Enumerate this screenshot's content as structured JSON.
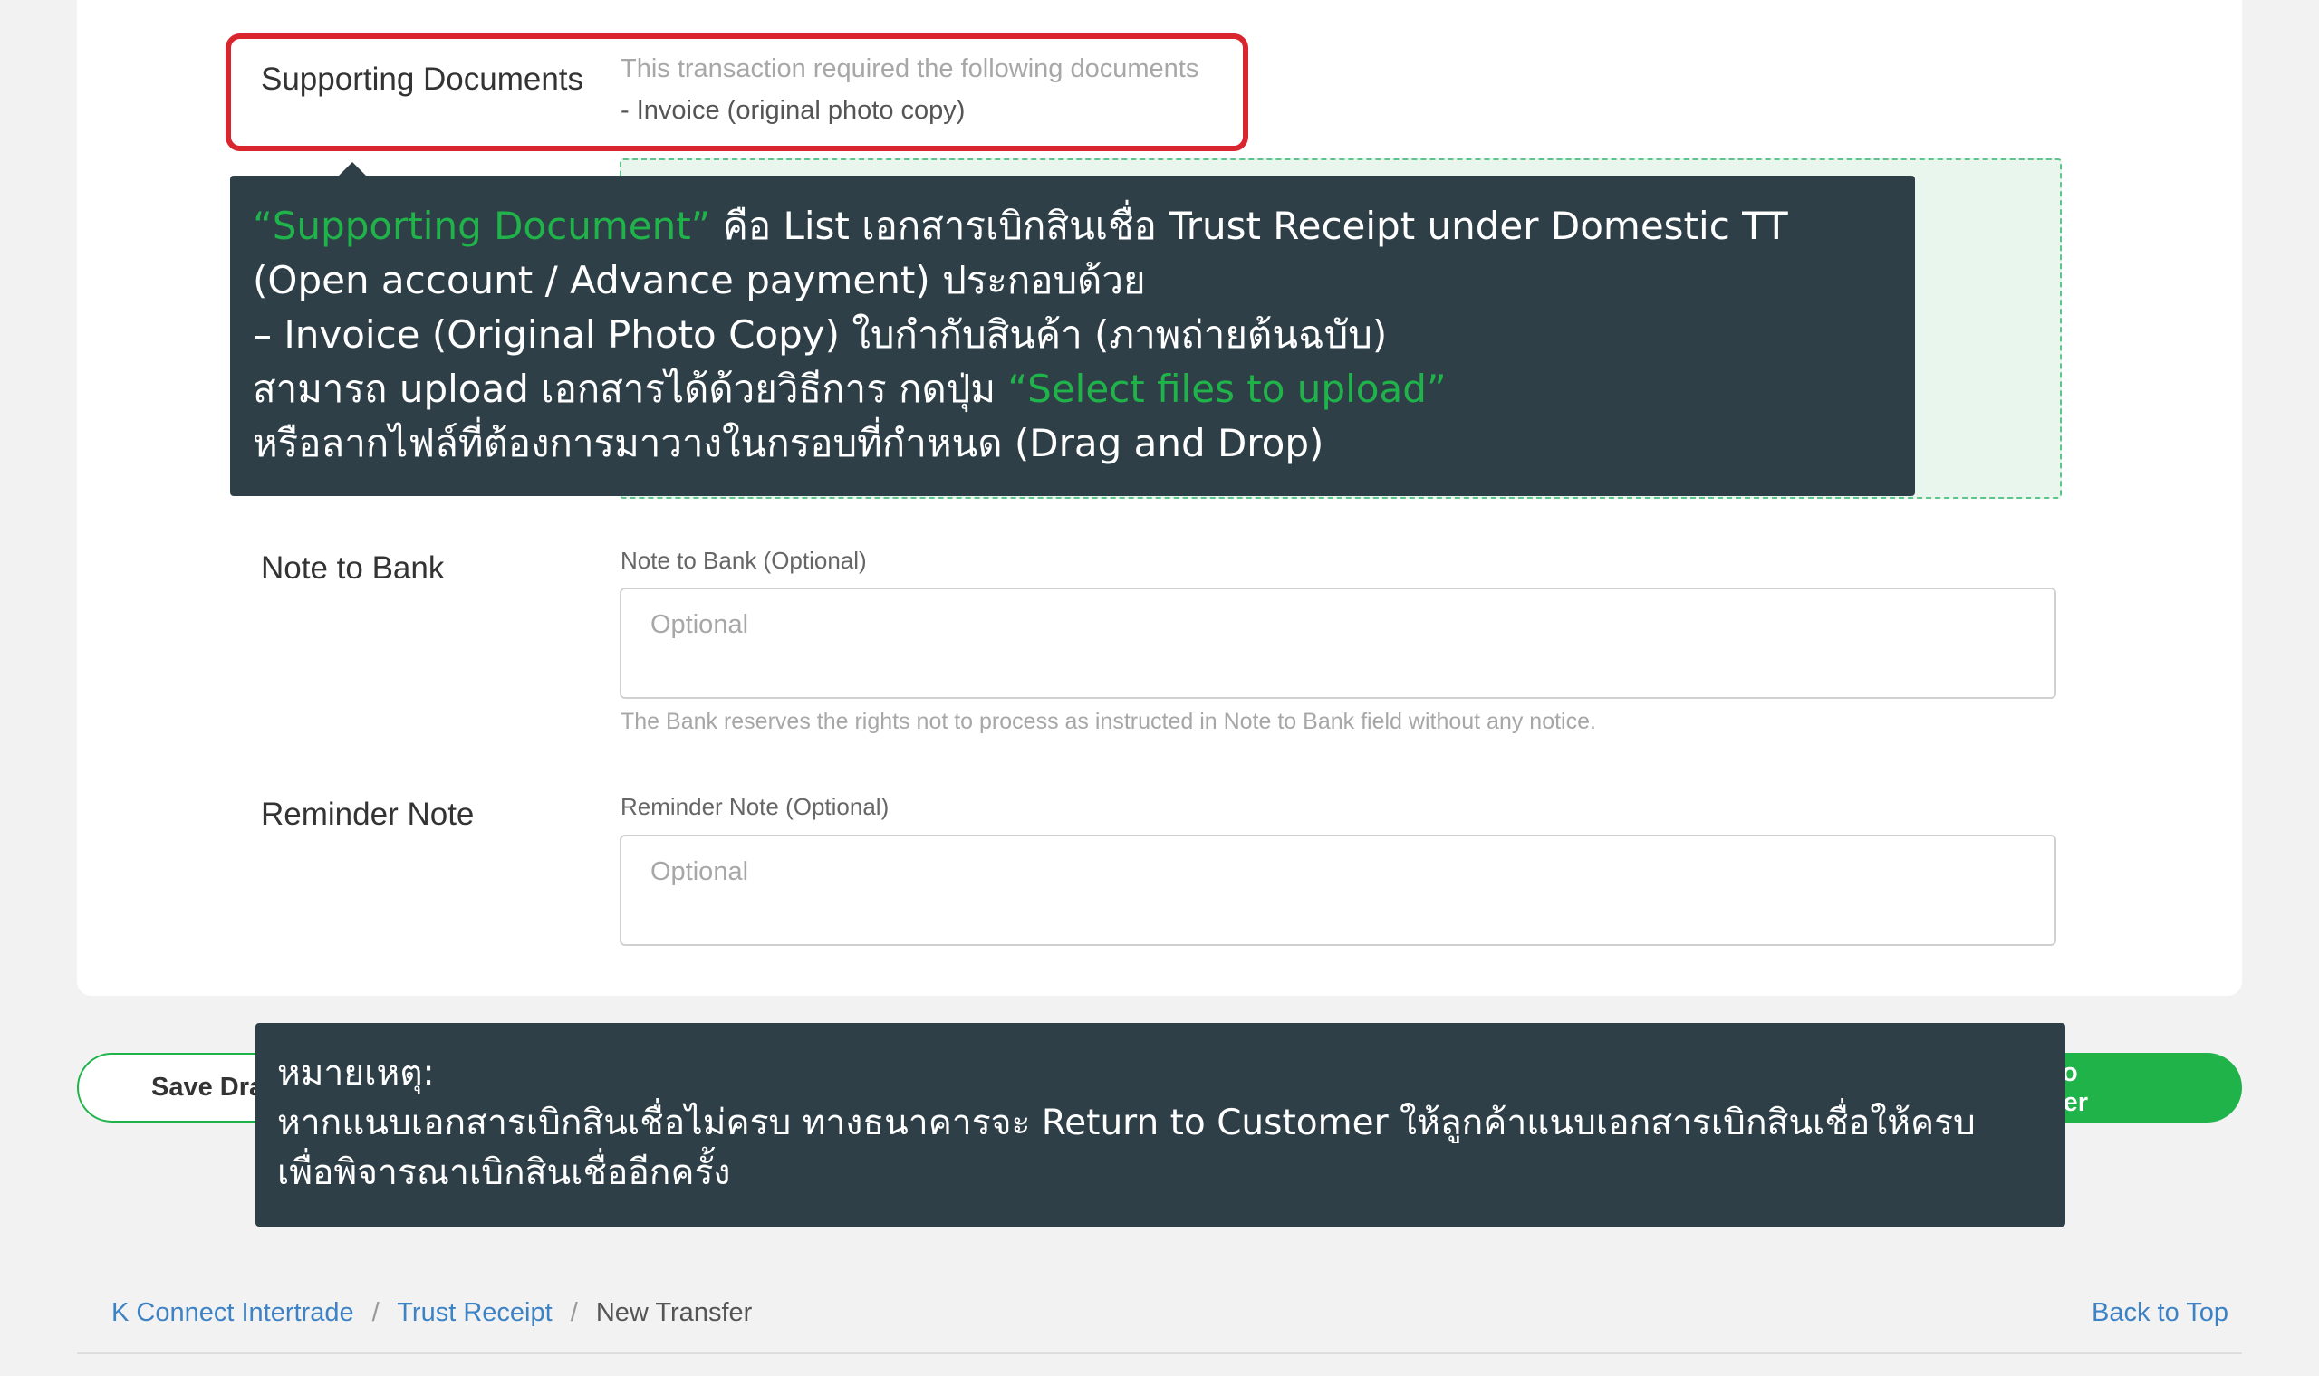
{
  "supporting": {
    "label": "Supporting Documents",
    "required_title": "This transaction required the following documents",
    "required_item": "- Invoice (original photo copy)"
  },
  "tooltip_main": {
    "l1_hl": "“Supporting Document”",
    "l1_rest": " คือ List เอกสารเบิกสินเชื่อ Trust Receipt under Domestic TT",
    "l2": "(Open account / Advance payment) ประกอบด้วย",
    "l3": "– Invoice (Original Photo Copy) ใบกำกับสินค้า (ภาพถ่ายต้นฉบับ)",
    "l4_pre": "สามารถ upload เอกสารได้ด้วยวิธีการ กดปุ่ม ",
    "l4_hl": "“Select files to upload”",
    "l5": "หรือลากไฟล์ที่ต้องการมาวางในกรอบที่กำหนด (Drag and Drop)"
  },
  "note_to_bank": {
    "section_label": "Note to Bank",
    "field_label": "Note to Bank (Optional)",
    "placeholder": "Optional",
    "hint": "The Bank reserves the rights not to process as instructed in Note to Bank field without any notice."
  },
  "reminder_note": {
    "section_label": "Reminder Note",
    "field_label": "Reminder Note (Optional)",
    "placeholder": "Optional"
  },
  "actions": {
    "save_draft": "Save Draft",
    "submit_authorizer": "Submit to Authorizer"
  },
  "tooltip_note": {
    "l1": "หมายเหตุ:",
    "l2": "หากแนบเอกสารเบิกสินเชื่อไม่ครบ ทางธนาคารจะ Return to Customer ให้ลูกค้าแนบเอกสารเบิกสินเชื่อให้ครบ",
    "l3": "เพื่อพิจารณาเบิกสินเชื่ออีกครั้ง"
  },
  "breadcrumb": {
    "items": [
      "K Connect Intertrade",
      "Trust Receipt",
      "New Transfer"
    ],
    "separator": "/"
  },
  "back_to_top": "Back to Top"
}
